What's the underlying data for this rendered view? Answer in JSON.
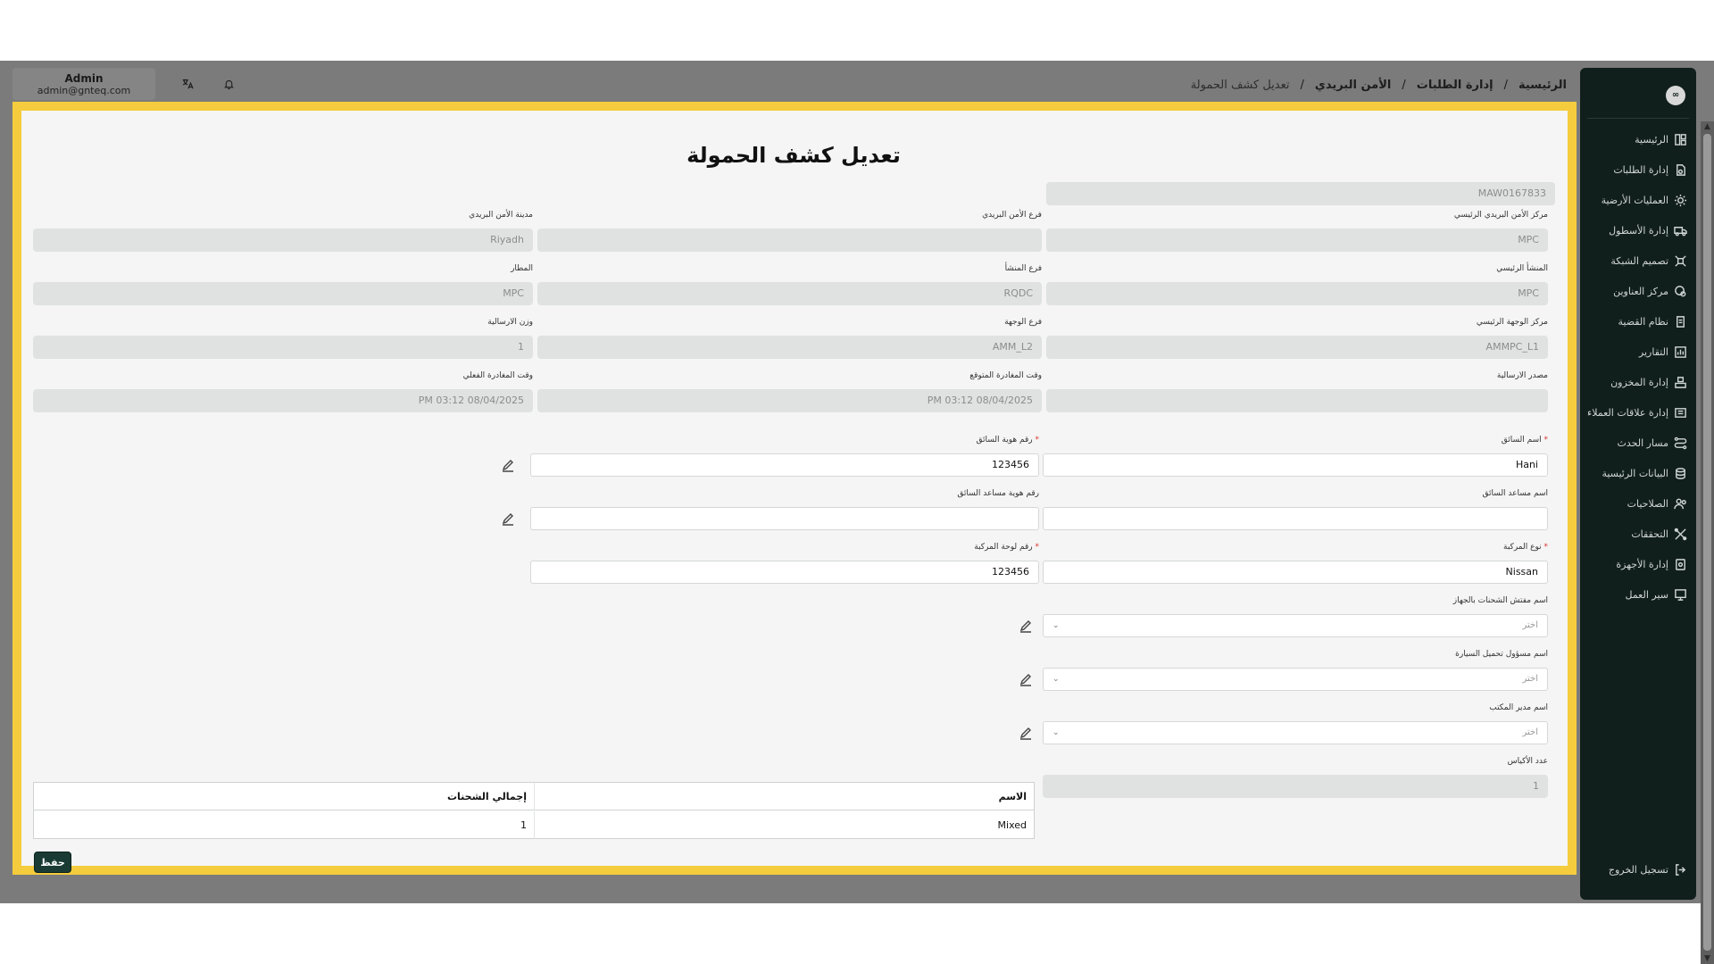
{
  "user": {
    "name": "Admin",
    "email": "admin@gnteq.com"
  },
  "breadcrumb": [
    {
      "label": "الرئيسية"
    },
    {
      "label": "إدارة الطلبات"
    },
    {
      "label": "الأمن البريدي"
    },
    {
      "label": "تعديل كشف الحمولة"
    }
  ],
  "breadcrumb_sep": "/",
  "sidebar": {
    "logo": "∞",
    "items": [
      {
        "label": "الرئيسية",
        "icon": "dashboard-icon"
      },
      {
        "label": "إدارة الطلبات",
        "icon": "orders-icon"
      },
      {
        "label": "العمليات الأرضية",
        "icon": "ground-ops-icon"
      },
      {
        "label": "إدارة الأسطول",
        "icon": "fleet-icon"
      },
      {
        "label": "تصميم الشبكة",
        "icon": "network-icon"
      },
      {
        "label": "مركز العناوين",
        "icon": "address-icon"
      },
      {
        "label": "نظام القضية",
        "icon": "case-icon"
      },
      {
        "label": "التقارير",
        "icon": "reports-icon"
      },
      {
        "label": "إدارة المخزون",
        "icon": "inventory-icon"
      },
      {
        "label": "إدارة علاقات العملاء",
        "icon": "crm-icon"
      },
      {
        "label": "مسار الحدث",
        "icon": "event-path-icon"
      },
      {
        "label": "البيانات الرئيسية",
        "icon": "database-icon"
      },
      {
        "label": "الصلاحيات",
        "icon": "users-icon"
      },
      {
        "label": "التحققات",
        "icon": "verify-icon"
      },
      {
        "label": "إدارة الأجهزة",
        "icon": "devices-icon"
      },
      {
        "label": "سير العمل",
        "icon": "workflow-icon"
      }
    ],
    "logout": "تسجيل الخروج"
  },
  "form": {
    "title": "تعديل كشف الحمولة",
    "manifest_no": "MAW0167833",
    "hub_label": "مركز الأمن البريدي الرئيسي",
    "hub_value": "MPC",
    "branch_label": "فرع الأمن البريدي",
    "branch_value": "",
    "city_label": "مدينة الأمن البريدي",
    "city_value": "Riyadh",
    "origin_label": "المنشأ الرئيسي",
    "origin_value": "MPC",
    "origin_branch_label": "فرع المنشأ",
    "origin_branch_value": "RQDC",
    "airport_label": "المطار",
    "airport_value": "MPC",
    "dest_hub_label": "مركز الوجهة الرئيسي",
    "dest_hub_value": "AMMPC_L1",
    "dest_branch_label": "فرع الوجهة",
    "dest_branch_value": "AMM_L2",
    "weight_label": "وزن الارسالية",
    "weight_value": "1",
    "source_label": "مصدر الارسالية",
    "source_value": "",
    "etd_label": "وقت المغادرة المتوقع",
    "etd_value": "08/04/2025 03:12 PM",
    "atd_label": "وقت المغادرة الفعلي",
    "atd_value": "08/04/2025 03:12 PM",
    "driver_name_label": "اسم السائق",
    "driver_name_value": "Hani",
    "driver_id_label": "رقم هوية السائق",
    "driver_id_value": "123456",
    "assistant_name_label": "اسم مساعد السائق",
    "assistant_name_value": "",
    "assistant_id_label": "رقم هوية مساعد السائق",
    "assistant_id_value": "",
    "vehicle_type_label": "نوع المركبة",
    "vehicle_type_value": "Nissan",
    "plate_label": "رقم لوحة المركبة",
    "plate_value": "123456",
    "inspector_label": "اسم مفتش الشحنات بالجهاز",
    "loader_label": "اسم مسؤول تحميل السيارة",
    "manager_label": "اسم مدير المكتب",
    "select_placeholder": "اختر",
    "bags_label": "عدد الأكياس",
    "bags_value": "1",
    "required_mark": "*"
  },
  "table": {
    "headers": [
      "الاسم",
      "إجمالي الشحنات"
    ],
    "rows": [
      [
        "Mixed",
        "1"
      ]
    ]
  },
  "save_label": "حفظ"
}
